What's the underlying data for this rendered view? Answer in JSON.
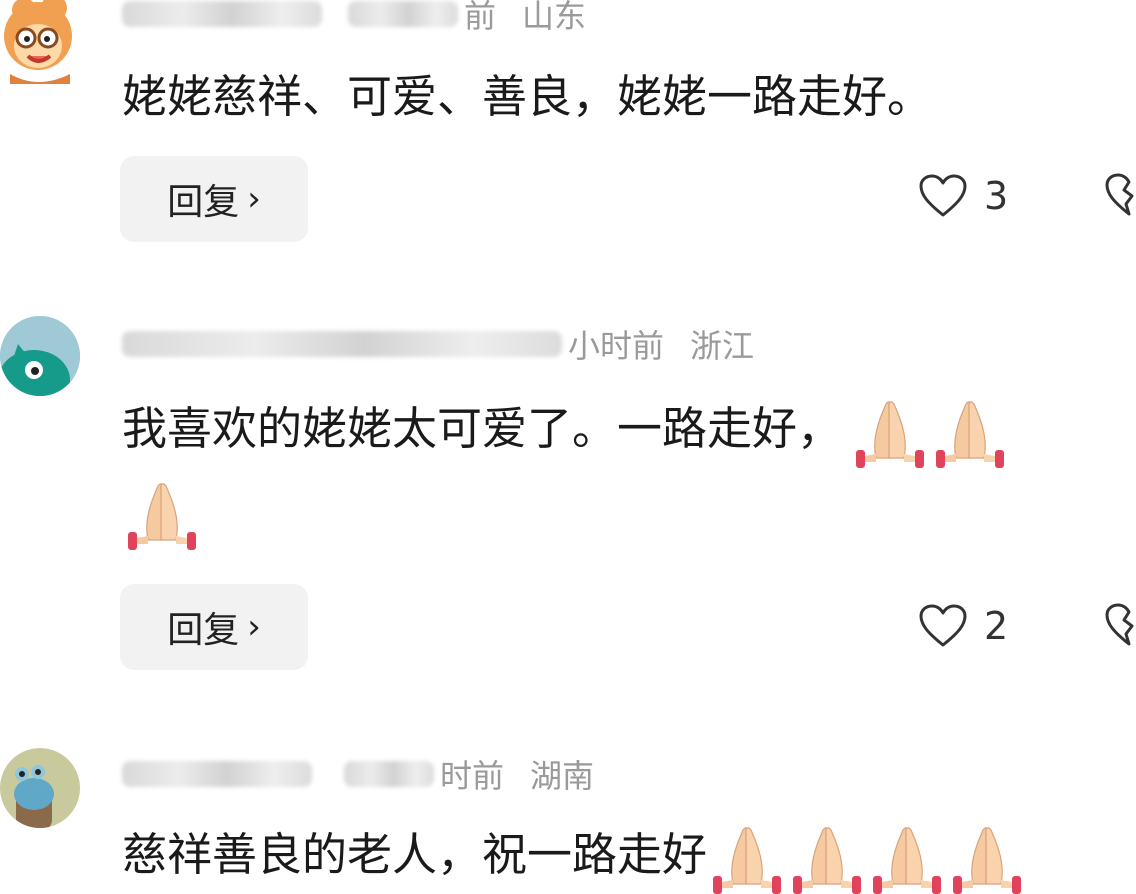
{
  "comments": [
    {
      "time": "前",
      "region": "山东",
      "text": "姥姥慈祥、可爱、善良，姥姥一路走好。",
      "reply_label": "回复",
      "likes": "3"
    },
    {
      "time": "小时前",
      "region": "浙江",
      "text_line1": "我喜欢的姥姥太可爱了。一路走好，",
      "reply_label": "回复",
      "likes": "2"
    },
    {
      "time": "时前",
      "region": "湖南",
      "text": "慈祥善良的老人，祝一路走好"
    }
  ],
  "icons": {
    "like": "heart-outline-icon",
    "dislike": "broken-heart-icon",
    "reply_chevron": "chevron-right-icon",
    "emoji": "folded-hands-emoji"
  },
  "colors": {
    "meta_text": "#9a9a9a",
    "reply_bg": "#f2f2f2",
    "pray_cuff": "#e0445d"
  }
}
